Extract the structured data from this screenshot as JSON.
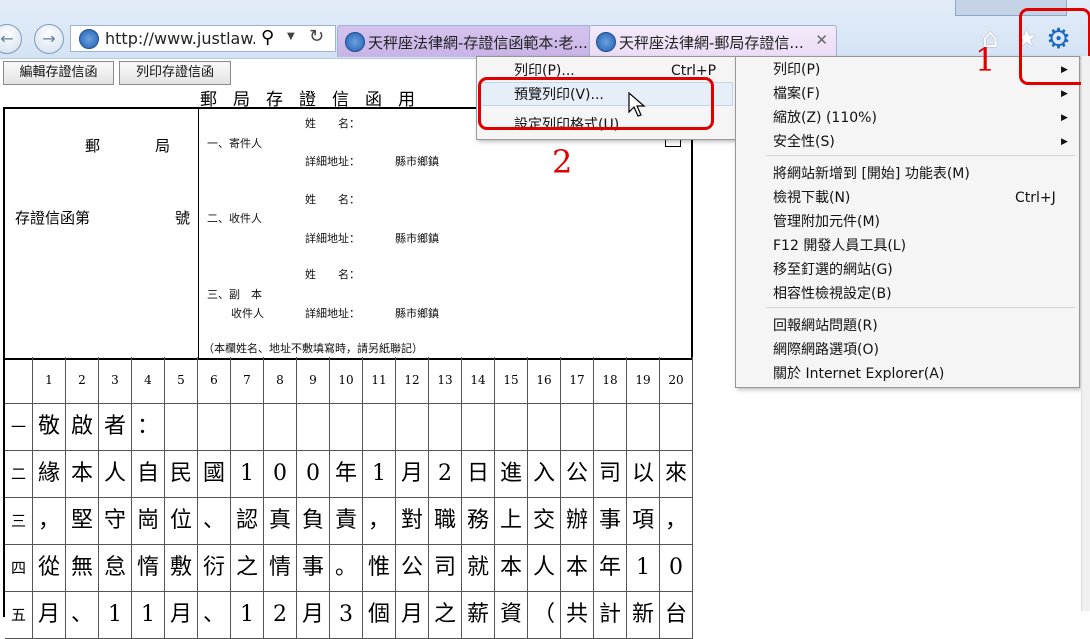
{
  "browser": {
    "address_url": "http://www.justlaw....",
    "tabs": [
      {
        "title": "天秤座法律網-存證信函範本:老..."
      },
      {
        "title": "天秤座法律網-郵局存證信..."
      }
    ]
  },
  "page": {
    "buttons": {
      "edit": "編輯存證信函",
      "print": "列印存證信函"
    },
    "doc_title": "郵局存證信函用",
    "left_top_a": "郵",
    "left_top_b": "局",
    "left_number_a": "存證信函第",
    "left_number_b": "號",
    "sender": "一、寄件人",
    "receiver": "二、收件人",
    "copy_a": "三、副　本",
    "copy_b": "收件人",
    "name_label": "姓　　名：",
    "address_label": "詳細地址：",
    "address_value": "縣市鄉鎮",
    "footnote": "（本欄姓名、地址不敷填寫時，請另紙聯記）",
    "grid_columns": [
      "1",
      "2",
      "3",
      "4",
      "5",
      "6",
      "7",
      "8",
      "9",
      "10",
      "11",
      "12",
      "13",
      "14",
      "15",
      "16",
      "17",
      "18",
      "19",
      "20"
    ],
    "grid_rows": [
      {
        "label": "一",
        "chars": [
          "敬",
          "啟",
          "者",
          "：",
          "",
          "",
          "",
          "",
          "",
          "",
          "",
          "",
          "",
          "",
          "",
          "",
          "",
          "",
          "",
          ""
        ]
      },
      {
        "label": "二",
        "chars": [
          "緣",
          "本",
          "人",
          "自",
          "民",
          "國",
          "1",
          "0",
          "0",
          "年",
          "1",
          "月",
          "2",
          "日",
          "進",
          "入",
          "公",
          "司",
          "以",
          "來"
        ]
      },
      {
        "label": "三",
        "chars": [
          "，",
          "堅",
          "守",
          "崗",
          "位",
          "、",
          "認",
          "真",
          "負",
          "責",
          "，",
          "對",
          "職",
          "務",
          "上",
          "交",
          "辦",
          "事",
          "項",
          "，"
        ]
      },
      {
        "label": "四",
        "chars": [
          "從",
          "無",
          "怠",
          "惰",
          "敷",
          "衍",
          "之",
          "情",
          "事",
          "。",
          "惟",
          "公",
          "司",
          "就",
          "本",
          "人",
          "本",
          "年",
          "1",
          "0"
        ]
      },
      {
        "label": "五",
        "chars": [
          "月",
          "、",
          "1",
          "1",
          "月",
          "、",
          "1",
          "2",
          "月",
          "3",
          "個",
          "月",
          "之",
          "薪",
          "資",
          "（",
          "共",
          "計",
          "新",
          "台"
        ]
      }
    ]
  },
  "print_submenu": {
    "items": [
      {
        "label": "列印(P)...",
        "shortcut": "Ctrl+P"
      },
      {
        "label": "預覽列印(V)...",
        "shortcut": ""
      },
      {
        "label": "設定列印格式(U)...",
        "shortcut": ""
      }
    ]
  },
  "tools_menu": {
    "items": [
      {
        "label": "列印(P)",
        "shortcut": "",
        "arrow": "▶"
      },
      {
        "label": "檔案(F)",
        "shortcut": "",
        "arrow": "▶"
      },
      {
        "label": "縮放(Z) (110%)",
        "shortcut": "",
        "arrow": "▶"
      },
      {
        "label": "安全性(S)",
        "shortcut": "",
        "arrow": "▶"
      },
      {
        "label": "將網站新增到 [開始] 功能表(M)",
        "shortcut": "",
        "arrow": ""
      },
      {
        "label": "檢視下載(N)",
        "shortcut": "Ctrl+J",
        "arrow": ""
      },
      {
        "label": "管理附加元件(M)",
        "shortcut": "",
        "arrow": ""
      },
      {
        "label": "F12 開發人員工具(L)",
        "shortcut": "",
        "arrow": ""
      },
      {
        "label": "移至釘選的網站(G)",
        "shortcut": "",
        "arrow": ""
      },
      {
        "label": "相容性檢視設定(B)",
        "shortcut": "",
        "arrow": ""
      },
      {
        "label": "回報網站問題(R)",
        "shortcut": "",
        "arrow": ""
      },
      {
        "label": "網際網路選項(O)",
        "shortcut": "",
        "arrow": ""
      },
      {
        "label": "關於 Internet Explorer(A)",
        "shortcut": "",
        "arrow": ""
      }
    ]
  },
  "annotations": {
    "step1": "1",
    "step2": "2",
    "color": "#e00000"
  }
}
